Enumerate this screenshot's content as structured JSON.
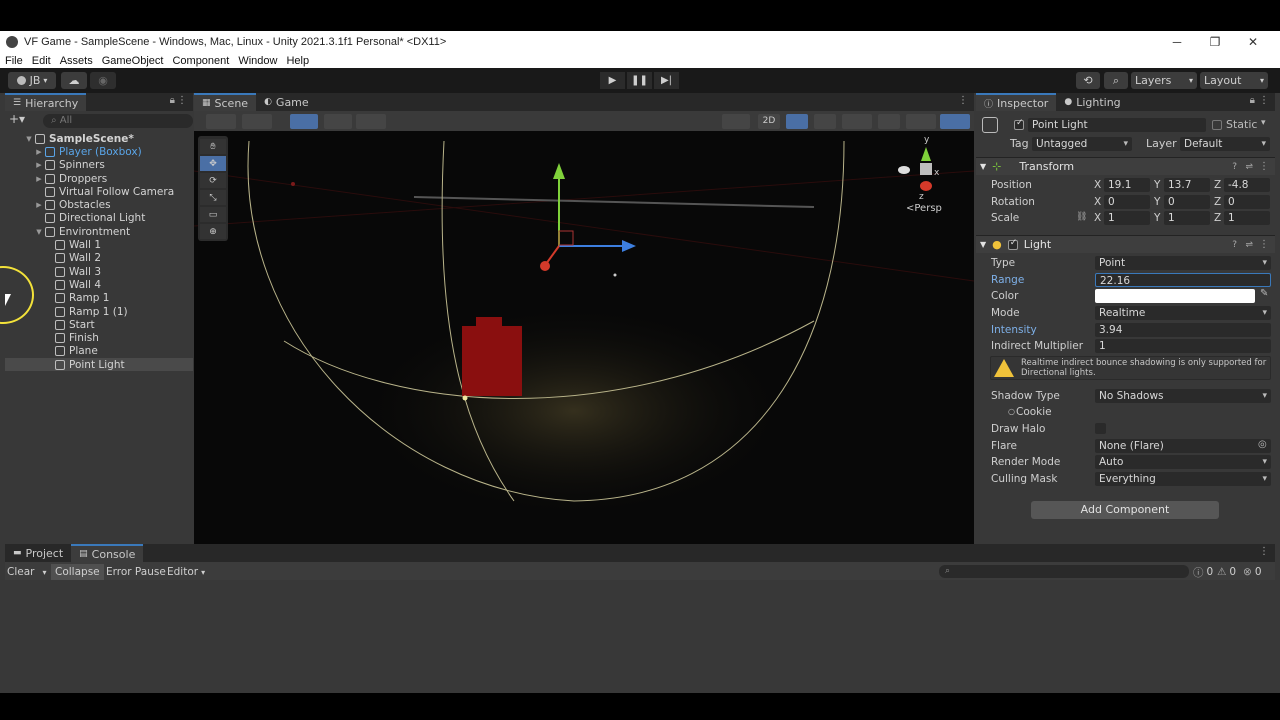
{
  "window": {
    "title": "VF Game - SampleScene - Windows, Mac, Linux - Unity 2021.3.1f1 Personal* <DX11>",
    "controls": [
      "─",
      "❐",
      "✕"
    ]
  },
  "menu": [
    "File",
    "Edit",
    "Assets",
    "GameObject",
    "Component",
    "Window",
    "Help"
  ],
  "toolbar": {
    "account": "JB",
    "layers": "Layers",
    "layout": "Layout"
  },
  "hierarchy": {
    "tab": "Hierarchy",
    "search_placeholder": "All",
    "items": [
      {
        "label": "SampleScene*",
        "depth": 0
      },
      {
        "label": "Player (Boxbox)",
        "depth": 1
      },
      {
        "label": "Spinners",
        "depth": 1
      },
      {
        "label": "Droppers",
        "depth": 1
      },
      {
        "label": "Virtual Follow Camera",
        "depth": 1
      },
      {
        "label": "Obstacles",
        "depth": 1
      },
      {
        "label": "Directional Light",
        "depth": 1
      },
      {
        "label": "Environtment",
        "depth": 1
      },
      {
        "label": "Wall 1",
        "depth": 2
      },
      {
        "label": "Wall 2",
        "depth": 2
      },
      {
        "label": "Wall 3",
        "depth": 2
      },
      {
        "label": "Wall 4",
        "depth": 2
      },
      {
        "label": "Ramp 1",
        "depth": 2
      },
      {
        "label": "Ramp 1 (1)",
        "depth": 2
      },
      {
        "label": "Start",
        "depth": 2
      },
      {
        "label": "Finish",
        "depth": 2
      },
      {
        "label": "Plane",
        "depth": 2
      },
      {
        "label": "Point Light",
        "depth": 2
      }
    ]
  },
  "scene": {
    "tabs": [
      "Scene",
      "Game"
    ],
    "mode_2d": "2D",
    "persp_label": "<Persp",
    "gizmo_axes": [
      "y",
      "x",
      "z"
    ]
  },
  "inspector": {
    "tabs": [
      "Inspector",
      "Lighting"
    ],
    "object_name": "Point Light",
    "static_label": "Static",
    "tag_label": "Tag",
    "tag_value": "Untagged",
    "layer_label": "Layer",
    "layer_value": "Default",
    "transform": {
      "title": "Transform",
      "position": {
        "label": "Position",
        "x": "19.1",
        "y": "13.7",
        "z": "-4.8"
      },
      "rotation": {
        "label": "Rotation",
        "x": "0",
        "y": "0",
        "z": "0"
      },
      "scale": {
        "label": "Scale",
        "x": "1",
        "y": "1",
        "z": "1"
      },
      "axis_x": "X",
      "axis_y": "Y",
      "axis_z": "Z"
    },
    "light": {
      "title": "Light",
      "type_label": "Type",
      "type_value": "Point",
      "range_label": "Range",
      "range_value": "22.16",
      "color_label": "Color",
      "mode_label": "Mode",
      "mode_value": "Realtime",
      "intensity_label": "Intensity",
      "intensity_value": "3.94",
      "indirect_label": "Indirect Multiplier",
      "indirect_value": "1",
      "warning": "Realtime indirect bounce shadowing is only supported for Directional lights.",
      "shadow_label": "Shadow Type",
      "shadow_value": "No Shadows",
      "cookie_label": "Cookie",
      "halo_label": "Draw Halo",
      "flare_label": "Flare",
      "flare_value": "None (Flare)",
      "render_label": "Render Mode",
      "render_value": "Auto",
      "culling_label": "Culling Mask",
      "culling_value": "Everything"
    },
    "add_component": "Add Component"
  },
  "bottom": {
    "tabs": [
      "Project",
      "Console"
    ],
    "clear": "Clear",
    "collapse": "Collapse",
    "error_pause": "Error Pause",
    "editor": "Editor",
    "counts": [
      "0",
      "0",
      "0"
    ]
  },
  "colors": {
    "accent": "#3a79bb",
    "selection": "#4a4a4a",
    "link_blue": "#7eb0e8"
  }
}
